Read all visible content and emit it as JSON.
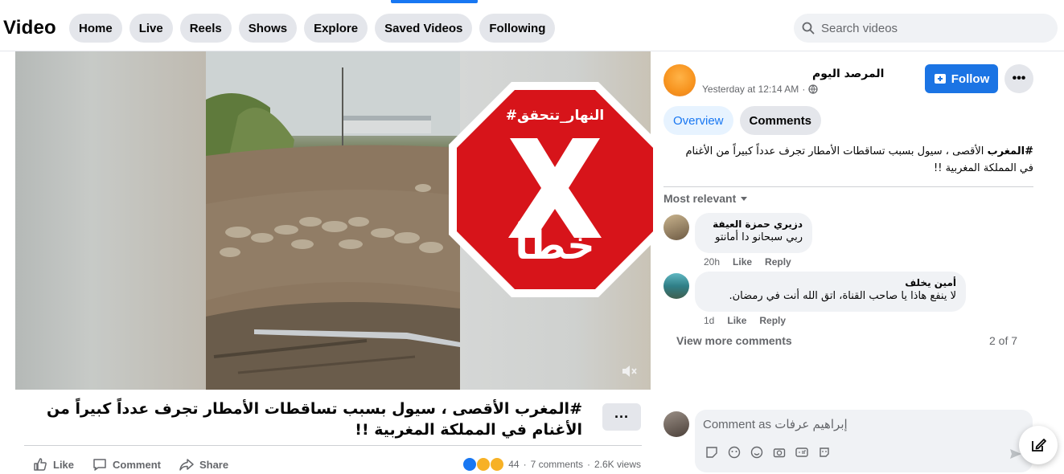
{
  "header": {
    "brand": "Video",
    "nav": [
      "Home",
      "Live",
      "Reels",
      "Shows",
      "Explore",
      "Saved Videos",
      "Following"
    ],
    "search_placeholder": "Search videos"
  },
  "video": {
    "stamp_tag": "#النهار_تتحقق",
    "stamp_letter": "X",
    "stamp_word": "خطأ",
    "stamp_color": "#d7141a"
  },
  "post": {
    "caption": "#المغرب الأقصى ، سيول بسبب تساقطات الأمطار تجرف عدداً كبيراً من الأغنام في المملكة المغربية !!",
    "more_label": "···",
    "actions": {
      "like": "Like",
      "comment": "Comment",
      "share": "Share"
    },
    "stats": {
      "reactions": "44",
      "comments": "7 comments",
      "views": "2.6K views",
      "separator": "·"
    }
  },
  "panel": {
    "page_name": "المرصد اليوم",
    "time": "Yesterday at 12:14 AM",
    "dot": "·",
    "follow_label": "Follow",
    "more_label": "•••",
    "tabs": [
      {
        "label": "Overview",
        "active": true
      },
      {
        "label": "Comments",
        "active": false
      }
    ],
    "description_tag": "#المغرب",
    "description_rest": " الأقصى ، سيول بسبب تساقطات الأمطار تجرف عدداً كبيراً من الأغنام في المملكة المغربية !!",
    "sort_label": "Most relevant",
    "comments": [
      {
        "name": "دزيري حمزة العيفة",
        "text": "ربي سبحانو دا أمانتو",
        "time": "20h",
        "like": "Like",
        "reply": "Reply"
      },
      {
        "name": "أمين يخلف",
        "text": "لا ينفع هاذا يا صاحب القناة، اتق الله أنت في رمضان.",
        "time": "1d",
        "like": "Like",
        "reply": "Reply"
      }
    ],
    "view_more": "View more comments",
    "count": "2 of 7",
    "composer_placeholder": "Comment as إبراهيم عرفات"
  },
  "colors": {
    "accent": "#1877f2",
    "follow": "#1b74e4",
    "tab_active_bg": "#e7f3ff"
  }
}
